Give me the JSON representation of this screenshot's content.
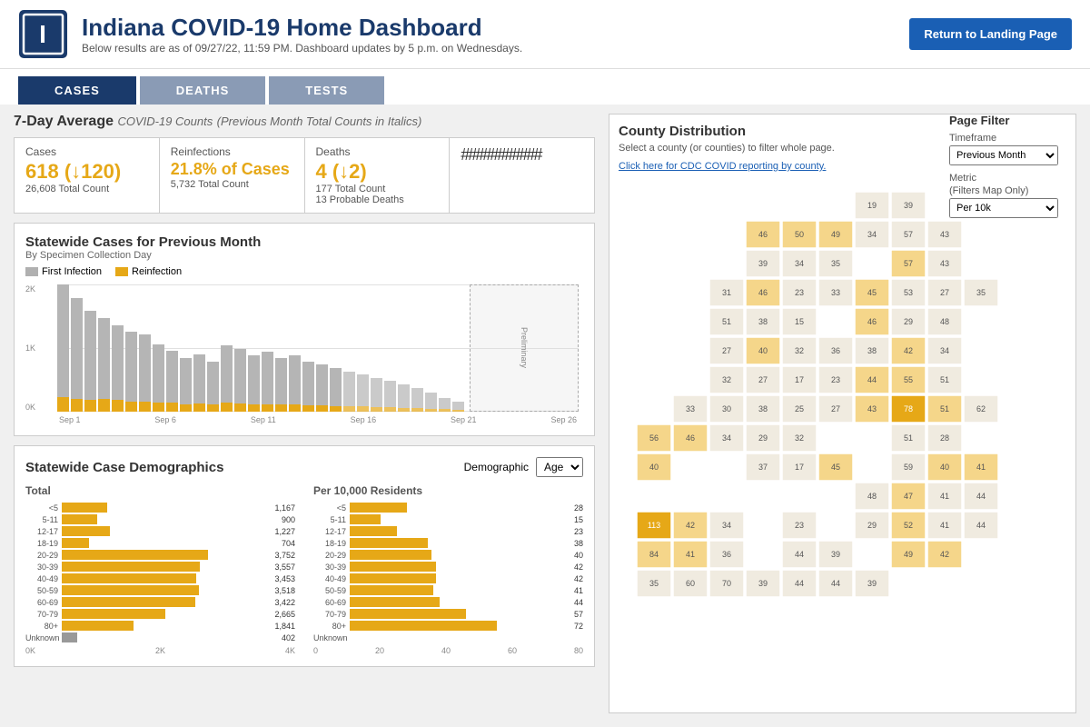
{
  "header": {
    "title": "Indiana COVID-19 Home Dashboard",
    "subtitle": "Below results are as of 09/27/22, 11:59 PM. Dashboard updates by 5 p.m. on Wednesdays.",
    "return_button": "Return to Landing Page"
  },
  "nav": {
    "tabs": [
      "CASES",
      "DEATHS",
      "TESTS"
    ],
    "active": "CASES"
  },
  "seven_day": {
    "title": "7-Day Average",
    "subtitle": "COVID-19 Counts",
    "italic": "(Previous Month Total Counts in Italics)",
    "stats": {
      "cases": {
        "label": "Cases",
        "value": "618 (↓120)",
        "sub": "26,608 Total Count"
      },
      "reinfections": {
        "label": "Reinfections",
        "value": "21.8% of Cases",
        "sub": "5,732 Total Count"
      },
      "deaths": {
        "label": "Deaths",
        "value": "4 (↓2)",
        "sub1": "177 Total Count",
        "sub2": "13 Probable Deaths"
      },
      "hash": "###########"
    }
  },
  "statewide_chart": {
    "title": "Statewide Cases for Previous Month",
    "subtitle": "By Specimen Collection Day",
    "legend": {
      "first_infection": "First Infection",
      "reinfection": "Reinfection"
    },
    "preliminary_label": "Preliminary",
    "x_labels": [
      "Sep 1",
      "Sep 6",
      "Sep 11",
      "Sep 16",
      "Sep 21",
      "Sep 26"
    ],
    "y_labels": [
      "2K",
      "1K",
      "0K"
    ]
  },
  "demographics": {
    "title": "Statewide Case Demographics",
    "demographic_label": "Demographic",
    "demographic_value": "Age",
    "total_label": "Total",
    "per10k_label": "Per 10,000 Residents",
    "age_groups": [
      "<5",
      "5-11",
      "12-17",
      "18-19",
      "20-29",
      "30-39",
      "40-49",
      "50-59",
      "60-69",
      "70-79",
      "80+",
      "Unknown"
    ],
    "total_values": [
      1167,
      900,
      1227,
      704,
      3752,
      3557,
      3453,
      3518,
      3422,
      2665,
      1841,
      402
    ],
    "per10k_values": [
      28,
      15,
      23,
      38,
      40,
      42,
      42,
      41,
      44,
      57,
      72,
      0
    ],
    "total_axis": [
      "0K",
      "2K",
      "4K"
    ],
    "per10k_axis": [
      "0",
      "20",
      "40",
      "60",
      "80"
    ]
  },
  "county_distribution": {
    "title": "County Distribution",
    "description": "Select a county (or counties) to filter whole page.",
    "cdc_link": "Click here for CDC COVID reporting by county."
  },
  "page_filter": {
    "title": "Page Filter",
    "timeframe_label": "Timeframe",
    "timeframe_value": "Previous Month",
    "metric_label": "Metric",
    "metric_sublabel": "(Filters Map Only)",
    "metric_value": "Per 10k"
  },
  "colors": {
    "accent_blue": "#1a3a6b",
    "orange": "#e6a817",
    "gray_bar": "#b5b5b5",
    "light_orange_map": "#f5d68a",
    "medium_orange_map": "#e6a817",
    "dark_orange_map": "#d4890a"
  }
}
